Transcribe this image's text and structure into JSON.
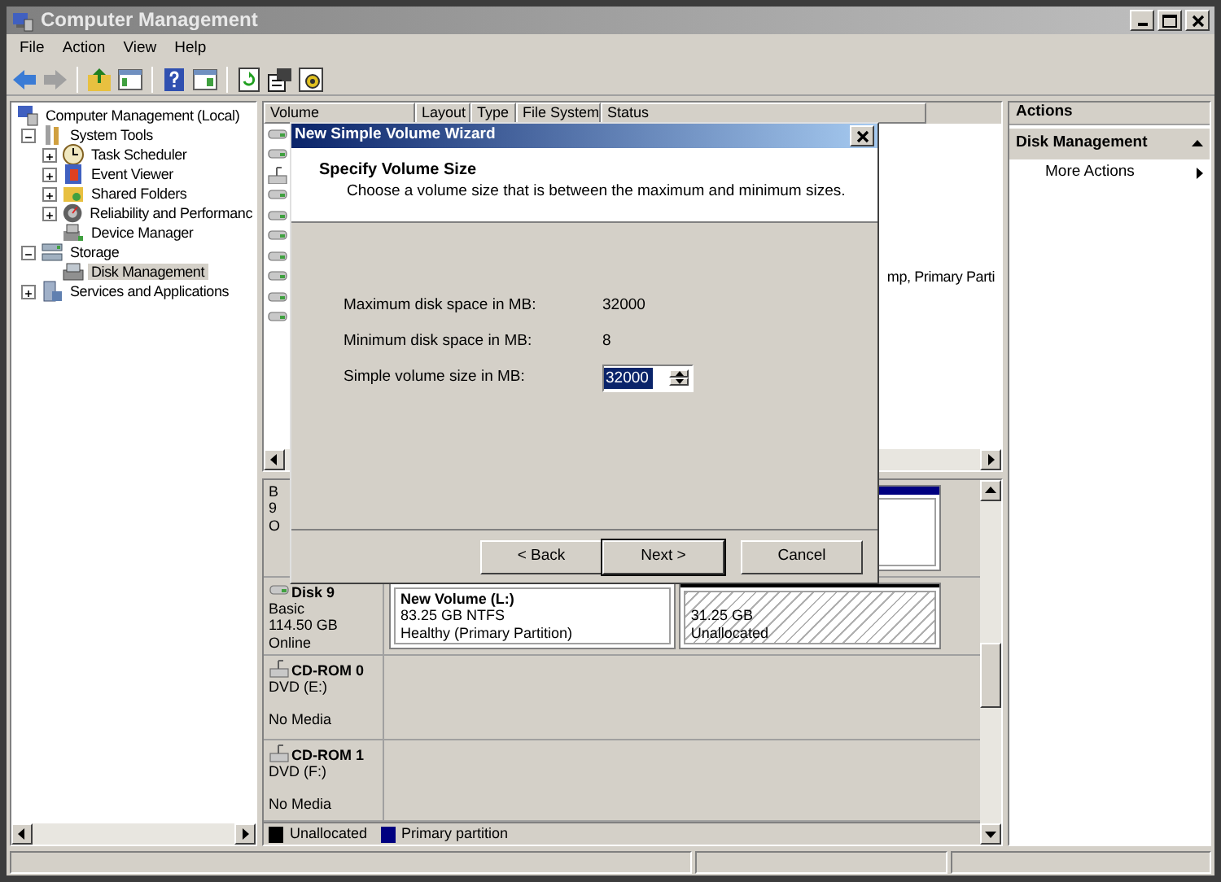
{
  "window": {
    "title": "Computer Management"
  },
  "menu": [
    "File",
    "Action",
    "View",
    "Help"
  ],
  "tree": [
    {
      "label": "Computer Management (Local)",
      "kind": "computer",
      "selected": false,
      "children": [
        {
          "label": "System Tools",
          "kind": "tools",
          "expanded": true,
          "selected": false,
          "children": [
            {
              "label": "Task Scheduler",
              "kind": "clock",
              "expanded": false,
              "selected": false
            },
            {
              "label": "Event Viewer",
              "kind": "event",
              "expanded": false,
              "selected": false
            },
            {
              "label": "Shared Folders",
              "kind": "folder",
              "expanded": false,
              "selected": false
            },
            {
              "label": "Reliability and Performanc",
              "kind": "gauge",
              "expanded": false,
              "selected": false
            },
            {
              "label": "Device Manager",
              "kind": "device",
              "selected": false
            }
          ]
        },
        {
          "label": "Storage",
          "kind": "storage",
          "expanded": true,
          "selected": false,
          "children": [
            {
              "label": "Disk Management",
              "kind": "disk",
              "selected": true
            }
          ]
        },
        {
          "label": "Services and Applications",
          "kind": "services",
          "expanded": false,
          "selected": false
        }
      ]
    }
  ],
  "volume_list": {
    "columns": [
      "Volume",
      "Layout",
      "Type",
      "File System",
      "Status"
    ],
    "rows": [
      {
        "kind": "disk"
      },
      {
        "kind": "disk"
      },
      {
        "kind": "cdrom"
      },
      {
        "kind": "disk"
      },
      {
        "kind": "disk"
      },
      {
        "kind": "disk"
      },
      {
        "kind": "disk"
      },
      {
        "kind": "disk",
        "status": "mp, Primary Parti"
      },
      {
        "kind": "disk"
      },
      {
        "kind": "disk"
      }
    ]
  },
  "disks": [
    {
      "lines": [
        "B",
        "9",
        "O"
      ],
      "partitions": [
        {
          "kind": "primary"
        }
      ]
    },
    {
      "kind": "disk",
      "name": "Disk 9",
      "lines": [
        "Basic",
        "114.50 GB",
        "Online"
      ],
      "partitions": [
        {
          "kind": "primary",
          "title": "New Volume  (L:)",
          "lines": [
            "83.25 GB NTFS",
            "Healthy (Primary Partition)"
          ]
        },
        {
          "kind": "unallocated",
          "lines": [
            "31.25 GB",
            "Unallocated"
          ]
        }
      ]
    },
    {
      "kind": "cdrom",
      "name": "CD-ROM 0",
      "lines": [
        "DVD (E:)"
      ],
      "status": "No Media"
    },
    {
      "kind": "cdrom",
      "name": "CD-ROM 1",
      "lines": [
        "DVD (F:)"
      ],
      "status": "No Media"
    }
  ],
  "legend": [
    {
      "label": "Unallocated",
      "color": "#000000"
    },
    {
      "label": "Primary partition",
      "color": "#000080"
    }
  ],
  "actions": {
    "title": "Actions",
    "section": "Disk Management",
    "expanded": true,
    "items": [
      "More Actions"
    ]
  },
  "wizard": {
    "title": "New Simple Volume Wizard",
    "heading": "Specify Volume Size",
    "subtitle": "Choose a volume size that is between the maximum and minimum sizes.",
    "fields": [
      {
        "kind": "text",
        "label": "Maximum disk space in MB:",
        "value": "32000"
      },
      {
        "kind": "text",
        "label": "Minimum disk space in MB:",
        "value": "8"
      },
      {
        "kind": "spin",
        "label": "Simple volume size in MB:",
        "value": "32000"
      }
    ],
    "buttons": [
      {
        "label": "< Back",
        "default": false
      },
      {
        "label": "Next >",
        "default": true
      },
      {
        "label": "Cancel",
        "default": false
      }
    ]
  }
}
